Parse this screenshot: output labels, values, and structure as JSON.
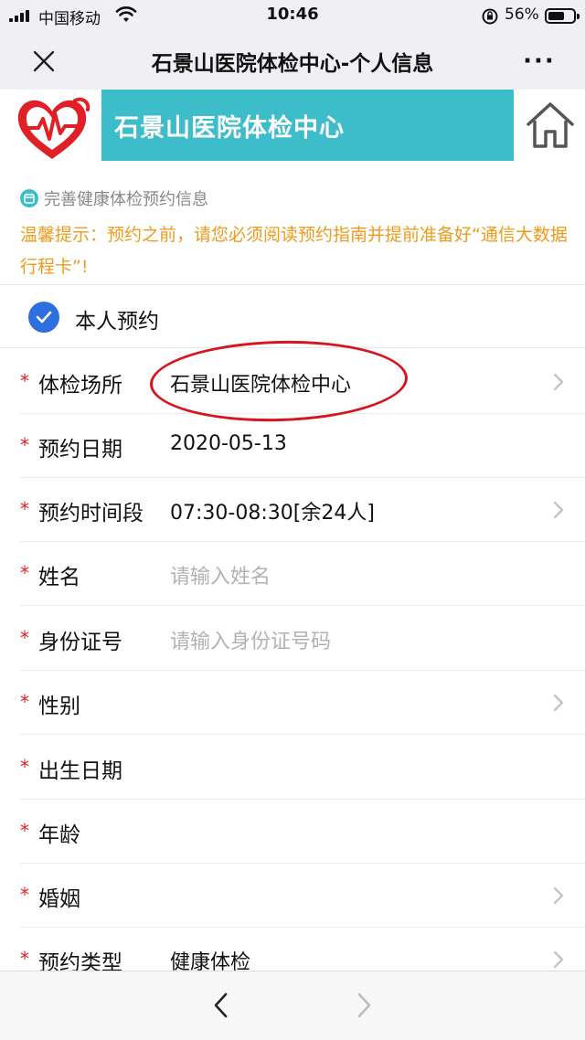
{
  "status_bar": {
    "carrier": "中国移动",
    "time": "10:46",
    "battery_percent": "56%",
    "battery_level": 0.56
  },
  "nav": {
    "title": "石景山医院体检中心-个人信息",
    "more_label": "···"
  },
  "banner": {
    "name": "石景山医院体检中心"
  },
  "notice": {
    "header": "完善健康体检预约信息",
    "tip": "温馨提示：预约之前，请您必须阅读预约指南并提前准备好“通信大数据行程卡”!"
  },
  "self_booking": {
    "label": "本人预约",
    "checked": true
  },
  "form": {
    "required_mark": "*",
    "rows": [
      {
        "label": "体检场所",
        "value": "石景山医院体检中心",
        "placeholder": "",
        "has_chevron": true
      },
      {
        "label": "预约日期",
        "value": "2020-05-13",
        "placeholder": "",
        "has_chevron": false
      },
      {
        "label": "预约时间段",
        "value": "07:30-08:30[余24人]",
        "placeholder": "",
        "has_chevron": true
      },
      {
        "label": "姓名",
        "value": "",
        "placeholder": "请输入姓名",
        "has_chevron": false
      },
      {
        "label": "身份证号",
        "value": "",
        "placeholder": "请输入身份证号码",
        "has_chevron": false
      },
      {
        "label": "性别",
        "value": "",
        "placeholder": "",
        "has_chevron": true
      },
      {
        "label": "出生日期",
        "value": "",
        "placeholder": "",
        "has_chevron": false
      },
      {
        "label": "年龄",
        "value": "",
        "placeholder": "",
        "has_chevron": false
      },
      {
        "label": "婚姻",
        "value": "",
        "placeholder": "",
        "has_chevron": true
      },
      {
        "label": "预约类型",
        "value": "健康体检",
        "placeholder": "",
        "has_chevron": true
      }
    ]
  },
  "colors": {
    "brand_teal": "#3dbcc9",
    "notice_orange": "#ef9a1a",
    "required_red": "#e02020",
    "check_blue": "#2e6fe0",
    "annotation_red": "#d4161f"
  },
  "icons": {
    "close": "close-icon",
    "more": "more-icon",
    "home": "home-icon",
    "calendar": "calendar-icon",
    "check": "checkmark-icon",
    "chevron": "chevron-right-icon",
    "back": "back-arrow-icon",
    "forward": "forward-arrow-icon"
  }
}
